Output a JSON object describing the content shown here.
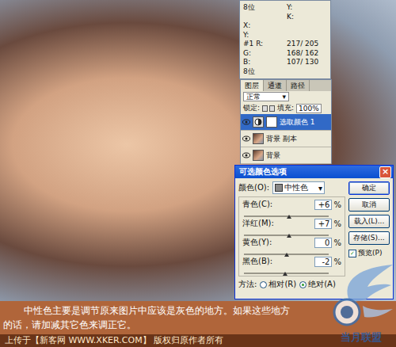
{
  "info": {
    "lines": [
      {
        "left": "8位",
        "right": "Y:"
      },
      {
        "left": "",
        "right": "K:"
      },
      {
        "left": "X:",
        "right": ""
      },
      {
        "left": "Y:",
        "right": ""
      },
      {
        "left": "#1 R:",
        "right": "217/ 205"
      },
      {
        "left": "G:",
        "right": "168/ 162"
      },
      {
        "left": "B:",
        "right": "107/ 130"
      },
      {
        "left": "8位",
        "right": ""
      }
    ]
  },
  "layers": {
    "tabs": [
      {
        "label": "图层",
        "selected": true
      },
      {
        "label": "通道",
        "selected": false
      },
      {
        "label": "路径",
        "selected": false
      }
    ],
    "blend": "正常",
    "lock_label": "锁定:",
    "fill_label": "填充:",
    "fill": "100%",
    "items": [
      {
        "name": "选取颜色 1",
        "kind": "adjustment",
        "visible": true,
        "selected": true
      },
      {
        "name": "背景 副本",
        "kind": "image",
        "visible": true,
        "selected": false
      },
      {
        "name": "背景",
        "kind": "image",
        "visible": true,
        "selected": false
      }
    ]
  },
  "dialog": {
    "title": "可选颜色选项",
    "close": "×",
    "color_label": "颜色(O):",
    "color_value": "中性色",
    "sliders": [
      {
        "label": "青色(C):",
        "value": "+6",
        "unit": "%",
        "level": 0.53
      },
      {
        "label": "洋红(M):",
        "value": "+7",
        "unit": "%",
        "level": 0.535
      },
      {
        "label": "黄色(Y):",
        "value": "0",
        "unit": "%",
        "level": 0.5
      },
      {
        "label": "黑色(B):",
        "value": "-2",
        "unit": "%",
        "level": 0.49
      }
    ],
    "buttons": [
      {
        "label": "确定",
        "focused": true
      },
      {
        "label": "取消",
        "focused": false
      },
      {
        "label": "载入(L)...",
        "focused": false
      },
      {
        "label": "存储(S)...",
        "focused": false
      }
    ],
    "preview": {
      "label": "预览(P)",
      "checked": true
    },
    "method_label": "方法:",
    "methods": [
      {
        "label": "相对(R)",
        "selected": false
      },
      {
        "label": "绝对(A)",
        "selected": true
      }
    ]
  },
  "caption": [
    "中性色主要是调节原来图片中应该是灰色的地方。如果这些地方",
    "的话，请加减其它色来调正它。"
  ],
  "footer": "上传于【新客网 WWW.XKER.COM】 版权归原作者所有",
  "watermark": {
    "text": "当月联盟"
  }
}
